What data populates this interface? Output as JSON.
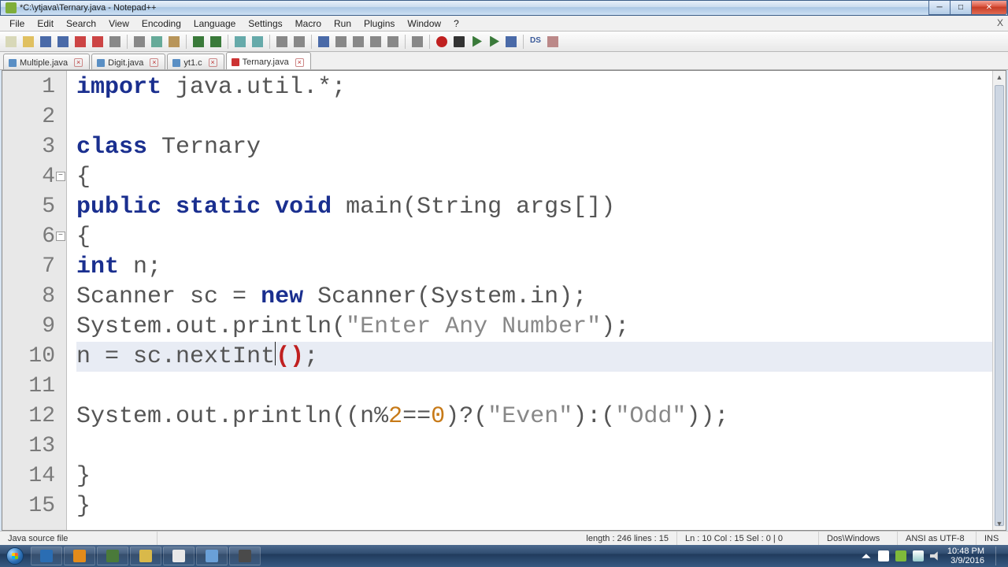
{
  "window": {
    "title": "*C:\\ytjava\\Ternary.java - Notepad++"
  },
  "menu": {
    "items": [
      "File",
      "Edit",
      "Search",
      "View",
      "Encoding",
      "Language",
      "Settings",
      "Macro",
      "Run",
      "Plugins",
      "Window",
      "?"
    ],
    "close_x": "X"
  },
  "tabs": [
    {
      "label": "Multiple.java",
      "active": false
    },
    {
      "label": "Digit.java",
      "active": false
    },
    {
      "label": "yt1.c",
      "active": false
    },
    {
      "label": "Ternary.java",
      "active": true
    }
  ],
  "code": {
    "lines": [
      {
        "n": 1,
        "tokens": [
          [
            "kw-blue",
            "import"
          ],
          [
            "",
            " java"
          ],
          [
            "",
            ".util"
          ],
          [
            "",
            ".*"
          ],
          [
            "",
            ";"
          ]
        ]
      },
      {
        "n": 2,
        "tokens": [
          [
            "",
            ""
          ]
        ]
      },
      {
        "n": 3,
        "tokens": [
          [
            "kw-blue",
            "class"
          ],
          [
            "",
            " Ternary"
          ]
        ]
      },
      {
        "n": 4,
        "tokens": [
          [
            "",
            "{"
          ]
        ],
        "fold": true
      },
      {
        "n": 5,
        "tokens": [
          [
            "kw-blue",
            "public"
          ],
          [
            "",
            " "
          ],
          [
            "kw-blue",
            "static"
          ],
          [
            "",
            " "
          ],
          [
            "kw-blue",
            "void"
          ],
          [
            "",
            " main"
          ],
          [
            "",
            "("
          ],
          [
            "",
            "String args"
          ],
          [
            "",
            "["
          ],
          [
            "",
            "]"
          ],
          [
            "",
            ")"
          ]
        ]
      },
      {
        "n": 6,
        "tokens": [
          [
            "",
            "{"
          ]
        ],
        "fold": true
      },
      {
        "n": 7,
        "tokens": [
          [
            "kw-blue",
            "int"
          ],
          [
            "",
            " n"
          ],
          [
            "",
            ";"
          ]
        ]
      },
      {
        "n": 8,
        "tokens": [
          [
            "",
            "Scanner sc "
          ],
          [
            "",
            "="
          ],
          [
            "",
            " "
          ],
          [
            "kw-blue",
            "new"
          ],
          [
            "",
            " Scanner"
          ],
          [
            "",
            "("
          ],
          [
            "",
            "System"
          ],
          [
            "",
            ".in"
          ],
          [
            "",
            ")"
          ],
          [
            "",
            ";"
          ]
        ]
      },
      {
        "n": 9,
        "tokens": [
          [
            "",
            "System"
          ],
          [
            "",
            ".out"
          ],
          [
            "",
            ".println"
          ],
          [
            "",
            "("
          ],
          [
            "str",
            "\"Enter Any Number\""
          ],
          [
            "",
            ")"
          ],
          [
            "",
            ";"
          ]
        ]
      },
      {
        "n": 10,
        "tokens": [
          [
            "",
            "n "
          ],
          [
            "",
            "="
          ],
          [
            "",
            " sc"
          ],
          [
            "",
            ".nextInt"
          ],
          [
            "paren-hl",
            "("
          ],
          [
            "paren-hl",
            ")"
          ],
          [
            "",
            ";"
          ]
        ],
        "hl": true,
        "caret_after": ".nextInt"
      },
      {
        "n": 11,
        "tokens": [
          [
            "",
            ""
          ]
        ]
      },
      {
        "n": 12,
        "tokens": [
          [
            "",
            "System"
          ],
          [
            "",
            ".out"
          ],
          [
            "",
            ".println"
          ],
          [
            "",
            "("
          ],
          [
            "",
            "("
          ],
          [
            "",
            "n"
          ],
          [
            "",
            "%"
          ],
          [
            "num",
            "2"
          ],
          [
            "",
            "=="
          ],
          [
            "num",
            "0"
          ],
          [
            "",
            ")"
          ],
          [
            "",
            "?"
          ],
          [
            "",
            "("
          ],
          [
            "str",
            "\"Even\""
          ],
          [
            "",
            ")"
          ],
          [
            "",
            ":"
          ],
          [
            "",
            "("
          ],
          [
            "str",
            "\"Odd\""
          ],
          [
            "",
            ")"
          ],
          [
            "",
            ")"
          ],
          [
            "",
            ";"
          ]
        ]
      },
      {
        "n": 13,
        "tokens": [
          [
            "",
            ""
          ]
        ]
      },
      {
        "n": 14,
        "tokens": [
          [
            "",
            "}"
          ]
        ]
      },
      {
        "n": 15,
        "tokens": [
          [
            "",
            "}"
          ]
        ]
      }
    ]
  },
  "status": {
    "left": "Java source file",
    "length": "length : 246    lines : 15",
    "pos": "Ln : 10    Col : 15    Sel : 0 | 0",
    "eol": "Dos\\Windows",
    "enc": "ANSI as UTF-8",
    "ins": "INS"
  },
  "taskbar": {
    "time": "10:48 PM",
    "date": "3/9/2016",
    "app_colors": [
      "#2a6db3",
      "#e38b1a",
      "#4a7a3a",
      "#d9b94a",
      "#e8e8e8",
      "#6aa0d8",
      "#4a4a4a"
    ]
  },
  "toolbar": {
    "icons": [
      "new",
      "open",
      "save",
      "save-all",
      "close",
      "close-all",
      "print",
      "sep",
      "cut",
      "copy",
      "paste",
      "sep",
      "undo",
      "redo",
      "sep",
      "find",
      "replace",
      "sep",
      "zoom-in",
      "zoom-out",
      "sep",
      "wrap",
      "all-chars",
      "indent",
      "fold",
      "unfold",
      "sep",
      "hidden",
      "sep",
      "record",
      "stop",
      "play",
      "play-multi",
      "save-macro",
      "sep",
      "ds",
      "compare"
    ]
  }
}
